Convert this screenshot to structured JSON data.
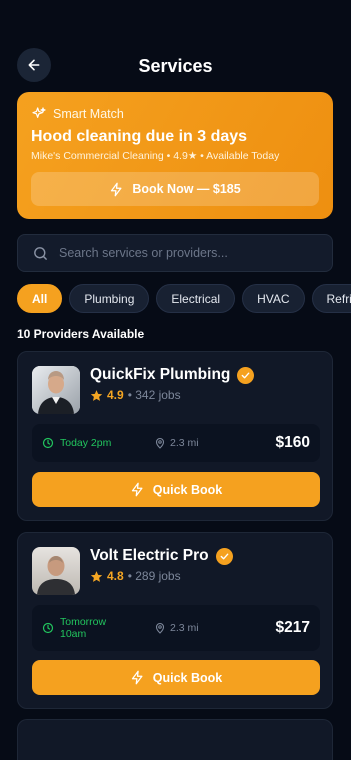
{
  "header": {
    "title": "Services"
  },
  "smart_match": {
    "label": "Smart Match",
    "title": "Hood cleaning due in 3 days",
    "subtitle": "Mike's Commercial Cleaning • 4.9★ • Available Today",
    "button_label": "Book Now — $185"
  },
  "search": {
    "placeholder": "Search services or providers..."
  },
  "categories": {
    "items": [
      "All",
      "Plumbing",
      "Electrical",
      "HVAC",
      "Refrig"
    ],
    "selected": "All"
  },
  "providers_count": "10 Providers Available",
  "providers": [
    {
      "name": "QuickFix Plumbing",
      "rating": "4.9",
      "jobs": "• 342 jobs",
      "availability": "Today 2pm",
      "distance": "2.3 mi",
      "price": "$160",
      "button_label": "Quick Book"
    },
    {
      "name": "Volt Electric Pro",
      "rating": "4.8",
      "jobs": "• 289 jobs",
      "availability": "Tomorrow\n10am",
      "distance": "2.3 mi",
      "price": "$217",
      "button_label": "Quick Book"
    }
  ],
  "colors": {
    "accent": "#f5a11f",
    "background": "#060b16",
    "card": "#111827",
    "success": "#22c55e",
    "star": "#f5a623"
  },
  "icons": {
    "back": "arrow-left-icon",
    "smart_match": "sparkles-icon",
    "book": "lightning-icon",
    "search": "search-icon",
    "verified": "check-badge-icon",
    "rating": "star-icon",
    "availability": "clock-icon",
    "distance": "map-pin-icon"
  }
}
